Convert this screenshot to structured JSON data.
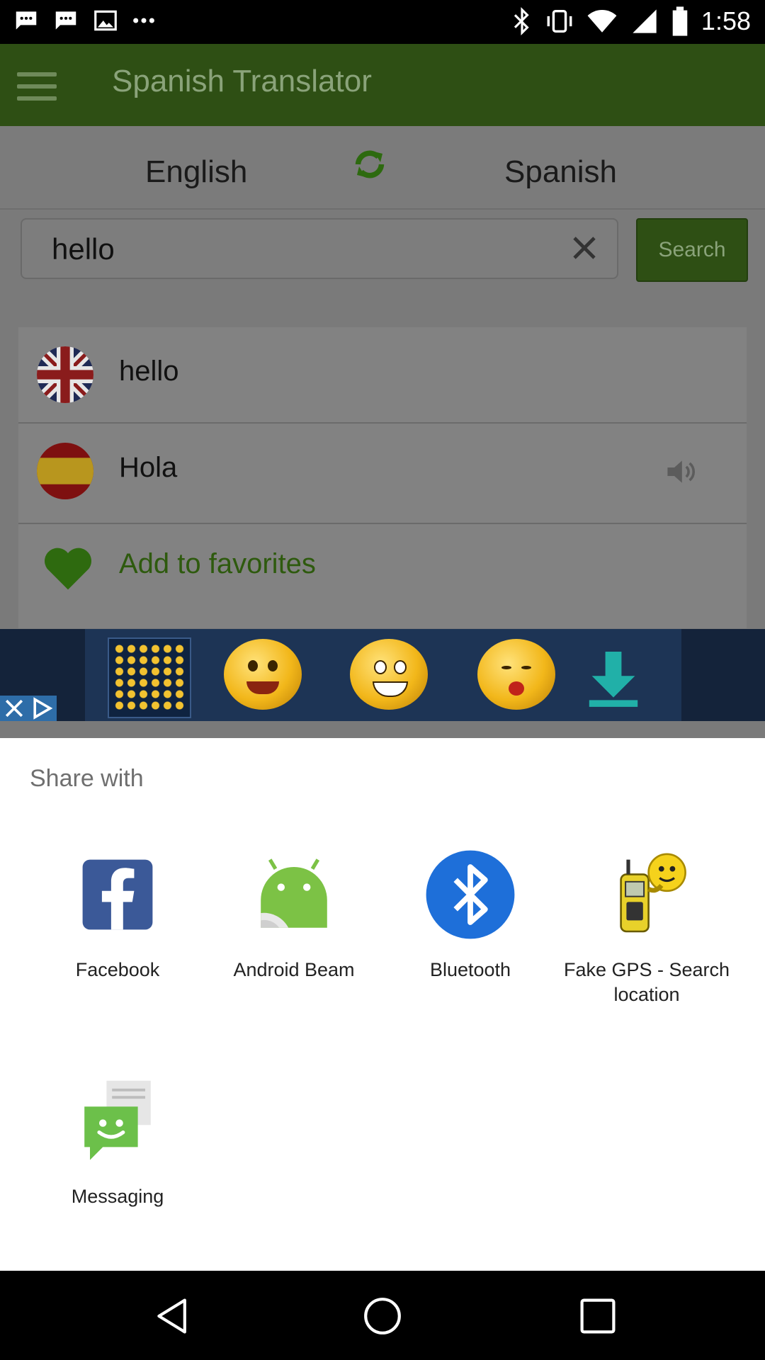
{
  "status_bar": {
    "time": "1:58",
    "icons": [
      "messages-icon",
      "messages-icon",
      "image-icon",
      "more-dots-icon",
      "bluetooth-icon",
      "vibrate-icon",
      "wifi-icon",
      "signal-icon",
      "battery-icon"
    ]
  },
  "app_bar": {
    "title": "Spanish Translator",
    "menu_icon": "hamburger-menu-icon"
  },
  "language_bar": {
    "source": "English",
    "target": "Spanish",
    "swap_icon": "refresh-swap-icon"
  },
  "search": {
    "value": "hello",
    "button_label": "Search",
    "clear_icon": "close-icon"
  },
  "results": {
    "rows": [
      {
        "text": "hello",
        "flag": "uk-flag-icon"
      },
      {
        "text": "Hola",
        "flag": "spain-flag-icon",
        "speaker_icon": "speaker-icon"
      }
    ],
    "favorites_label": "Add to favorites",
    "favorites_icon": "heart-icon"
  },
  "ad_banner": {
    "icons": [
      "ad-close-icon",
      "ad-choices-icon",
      "keyboard-icon",
      "emoji-icon",
      "download-arrow-icon"
    ]
  },
  "share_sheet": {
    "title": "Share with",
    "apps": [
      {
        "label": "Facebook",
        "icon": "facebook-icon"
      },
      {
        "label": "Android Beam",
        "icon": "android-beam-icon"
      },
      {
        "label": "Bluetooth",
        "icon": "bluetooth-icon"
      },
      {
        "label": "Fake GPS - Search location",
        "icon": "fake-gps-icon"
      },
      {
        "label": "Messaging",
        "icon": "messaging-icon"
      }
    ]
  },
  "nav_bar": {
    "icons": [
      "back-icon",
      "home-icon",
      "recents-icon"
    ]
  },
  "colors": {
    "app_bar": "#2e4f14",
    "accent_green": "#4caf50",
    "facebook_blue": "#3b5998",
    "bluetooth_blue": "#1e6fd9"
  }
}
